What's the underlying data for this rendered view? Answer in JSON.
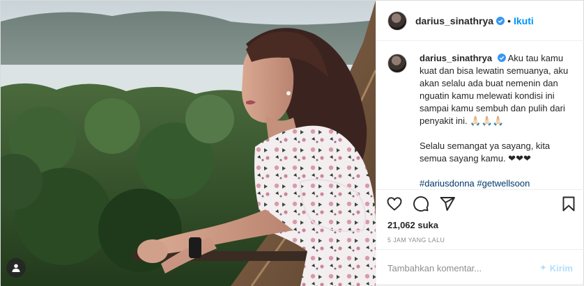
{
  "post": {
    "author": {
      "username": "darius_sinathrya",
      "verified": true,
      "follow_label": "Ikuti",
      "separator": "•"
    },
    "caption": {
      "username": "darius_sinathrya",
      "paragraphs": [
        "Aku tau kamu kuat dan bisa lewatin semuanya, aku akan selalu ada buat nemenin dan nguatin kamu melewati kondisi ini sampai kamu sembuh dan pulih dari penyakit ini. 🙏🏻🙏🏻🙏🏻",
        "Selalu semangat ya sayang, kita semua sayang kamu. ❤❤❤"
      ],
      "caption_tail_1": "▯▯▯",
      "hashtags": [
        "#dariusdonna",
        "#getwellsoon"
      ]
    },
    "actions": {
      "like_icon": "heart-icon",
      "comment_icon": "comment-icon",
      "share_icon": "share-icon",
      "save_icon": "bookmark-icon"
    },
    "likes_text": "21,062 suka",
    "time_text": "5 JAM YANG LALU",
    "comment_box": {
      "placeholder": "Tambahkan komentar...",
      "emoji": "✦",
      "send_label": "Kirim"
    },
    "photo": {
      "tag_icon": "user-tag-icon"
    },
    "colors": {
      "accent": "#0095f6",
      "hashtag": "#00376b",
      "muted": "#8e8e8e"
    }
  }
}
